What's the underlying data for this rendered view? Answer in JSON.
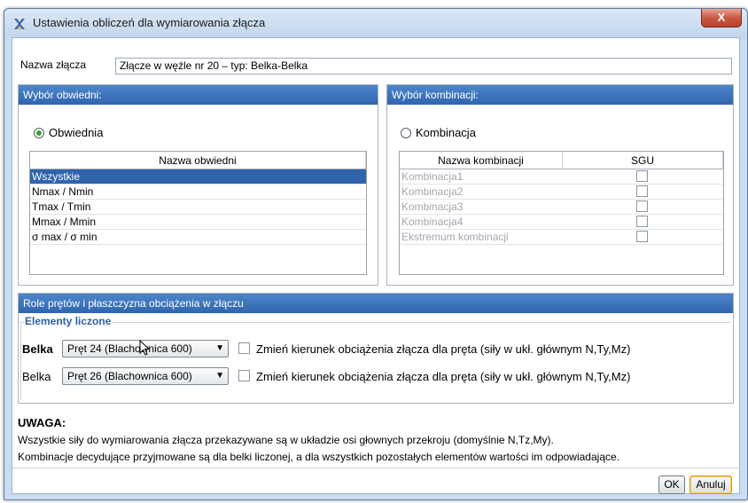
{
  "window": {
    "title": "Ustawienia obliczeń dla wymiarowania złącza",
    "close_glyph": "X"
  },
  "name": {
    "label": "Nazwa złącza",
    "value": "Złącze w węźle nr 20 – typ: Belka-Belka"
  },
  "envelope": {
    "header": "Wybór obwiedni:",
    "radio_label": "Obwiednia",
    "radio_checked": true,
    "column": "Nazwa obwiedni",
    "rows": [
      "Wszystkie",
      "Nmax / Nmin",
      "Tmax / Tmin",
      "Mmax / Mmin",
      "σ max / σ min"
    ],
    "selected_index": 0
  },
  "combination": {
    "header": "Wybór kombinacji:",
    "radio_label": "Kombinacja",
    "radio_checked": false,
    "columns": [
      "Nazwa kombinacji",
      "SGU"
    ],
    "rows": [
      "Kombinacja1",
      "Kombinacja2",
      "Kombinacja3",
      "Kombinacja4",
      "Ekstremum kombinacji"
    ]
  },
  "roles": {
    "header": "Role prętów i płaszczyzna obciążenia w złączu",
    "group_legend": "Elementy liczone",
    "members": [
      {
        "label": "Belka",
        "bold": true,
        "bar": "Pręt 24 (Blachownica 600)",
        "checkbox_label": "Zmień kierunek obciążenia złącza dla pręta (siły w ukł. głównym N,Ty,Mz)"
      },
      {
        "label": "Belka",
        "bold": false,
        "bar": "Pręt 26 (Blachownica 600)",
        "checkbox_label": "Zmień kierunek obciążenia złącza dla pręta (siły w ukł. głównym N,Ty,Mz)"
      }
    ]
  },
  "note": {
    "title": "UWAGA:",
    "line1": "Wszystkie siły do wymiarowania złącza przekazywane są w układzie osi głownych przekroju (domyślnie N,Tz,My).",
    "line2": "Kombinacje decydujące przyjmowane są dla belki liczonej, a dla wszystkich pozostałych elementów wartości im odpowiadające."
  },
  "buttons": {
    "ok": "OK",
    "cancel": "Anuluj"
  },
  "colors": {
    "panel_header": "#2f65ad",
    "selection": "#2f64ad",
    "legend": "#2f5fa8"
  }
}
